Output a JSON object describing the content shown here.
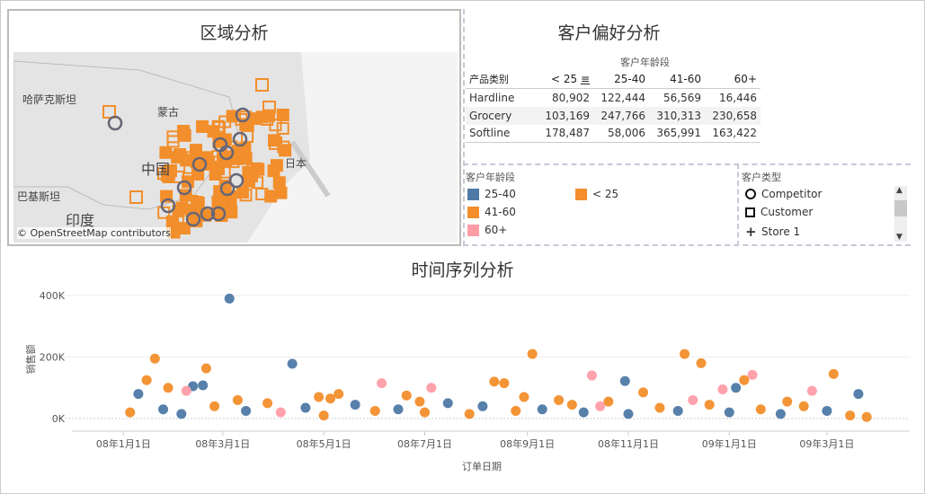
{
  "region": {
    "title": "区域分析",
    "labels": [
      "哈萨克斯坦",
      "蒙古",
      "中国",
      "日本",
      "巴基斯坦",
      "印度"
    ],
    "attribution": "© OpenStreetMap contributors"
  },
  "preference": {
    "title": "客户偏好分析",
    "column_group": "客户年龄段",
    "row_header": "产品类别",
    "columns": [
      "< 25",
      "25-40",
      "41-60",
      "60+"
    ],
    "rows": [
      {
        "name": "Hardline",
        "values": [
          "80,902",
          "122,444",
          "56,569",
          "16,446"
        ]
      },
      {
        "name": "Grocery",
        "values": [
          "103,169",
          "247,766",
          "310,313",
          "230,658"
        ]
      },
      {
        "name": "Softline",
        "values": [
          "178,487",
          "58,006",
          "365,991",
          "163,422"
        ]
      }
    ]
  },
  "age_legend": {
    "title": "客户年龄段",
    "items": [
      {
        "label": "25-40",
        "color": "#4e79a7"
      },
      {
        "label": "< 25",
        "color": "#f28e2b"
      },
      {
        "label": "41-60",
        "color": "#f28e2b"
      },
      {
        "label": "60+",
        "color": "#ff9da7"
      }
    ]
  },
  "type_legend": {
    "title": "客户类型",
    "items": [
      {
        "label": "Competitor",
        "icon": "circle-icon"
      },
      {
        "label": "Customer",
        "icon": "square-icon"
      },
      {
        "label": "Store 1",
        "icon": "plus-icon"
      }
    ]
  },
  "chart_data": {
    "type": "scatter",
    "title": "时间序列分析",
    "xlabel": "订单日期",
    "ylabel": "销售额",
    "ylim": [
      0,
      400000
    ],
    "yticks": [
      {
        "v": 0,
        "label": "0K"
      },
      {
        "v": 200000,
        "label": "200K"
      },
      {
        "v": 400000,
        "label": "400K"
      }
    ],
    "xticks": [
      {
        "d": "2008-01-01",
        "label": "08年1月1日"
      },
      {
        "d": "2008-03-01",
        "label": "08年3月1日"
      },
      {
        "d": "2008-05-01",
        "label": "08年5月1日"
      },
      {
        "d": "2008-07-01",
        "label": "08年7月1日"
      },
      {
        "d": "2008-09-01",
        "label": "08年9月1日"
      },
      {
        "d": "2008-11-01",
        "label": "08年11月1日"
      },
      {
        "d": "2009-01-01",
        "label": "09年1月1日"
      },
      {
        "d": "2009-03-01",
        "label": "09年3月1日"
      }
    ],
    "xlim": [
      "2007-11-20",
      "2009-04-20"
    ],
    "colors": {
      "25-40": "#4e79a7",
      "< 25": "#f28e2b",
      "41-60": "#f28e2b",
      "60+": "#ff9da7"
    },
    "points": [
      [
        "2008-03-05",
        390000,
        "25-40"
      ],
      [
        "2008-01-20",
        195000,
        "< 25"
      ],
      [
        "2008-02-20",
        163000,
        "< 25"
      ],
      [
        "2008-04-12",
        178000,
        "25-40"
      ],
      [
        "2008-09-04",
        210000,
        "41-60"
      ],
      [
        "2008-12-05",
        210000,
        "41-60"
      ],
      [
        "2008-12-15",
        180000,
        "41-60"
      ],
      [
        "2009-03-05",
        145000,
        "< 25"
      ],
      [
        "2009-01-15",
        142000,
        "60+"
      ],
      [
        "2008-10-30",
        122000,
        "25-40"
      ],
      [
        "2008-10-10",
        140000,
        "60+"
      ],
      [
        "2008-01-10",
        80000,
        "25-40"
      ],
      [
        "2008-01-15",
        125000,
        "< 25"
      ],
      [
        "2008-01-28",
        100000,
        "< 25"
      ],
      [
        "2008-02-12",
        105000,
        "25-40"
      ],
      [
        "2008-02-18",
        108000,
        "25-40"
      ],
      [
        "2008-02-08",
        90000,
        "60+"
      ],
      [
        "2008-08-12",
        120000,
        "< 25"
      ],
      [
        "2008-08-18",
        115000,
        "< 25"
      ],
      [
        "2008-06-05",
        115000,
        "60+"
      ],
      [
        "2008-07-05",
        100000,
        "60+"
      ],
      [
        "2009-01-05",
        100000,
        "25-40"
      ],
      [
        "2009-01-10",
        125000,
        "< 25"
      ],
      [
        "2008-12-28",
        95000,
        "60+"
      ],
      [
        "2009-03-20",
        80000,
        "25-40"
      ],
      [
        "2009-02-20",
        90000,
        "60+"
      ],
      [
        "2008-05-10",
        80000,
        "< 25"
      ],
      [
        "2008-06-20",
        75000,
        "< 25"
      ],
      [
        "2008-09-20",
        60000,
        "< 25"
      ],
      [
        "2008-11-10",
        85000,
        "< 25"
      ],
      [
        "2008-01-05",
        20000,
        "< 25"
      ],
      [
        "2008-01-25",
        30000,
        "25-40"
      ],
      [
        "2008-02-05",
        15000,
        "25-40"
      ],
      [
        "2008-02-25",
        40000,
        "< 25"
      ],
      [
        "2008-03-15",
        25000,
        "25-40"
      ],
      [
        "2008-03-28",
        50000,
        "< 25"
      ],
      [
        "2008-04-05",
        20000,
        "60+"
      ],
      [
        "2008-04-20",
        35000,
        "25-40"
      ],
      [
        "2008-05-01",
        10000,
        "< 25"
      ],
      [
        "2008-05-20",
        45000,
        "25-40"
      ],
      [
        "2008-06-01",
        25000,
        "< 25"
      ],
      [
        "2008-06-15",
        30000,
        "25-40"
      ],
      [
        "2008-07-01",
        20000,
        "< 25"
      ],
      [
        "2008-07-15",
        50000,
        "25-40"
      ],
      [
        "2008-07-28",
        15000,
        "< 25"
      ],
      [
        "2008-08-05",
        40000,
        "25-40"
      ],
      [
        "2008-08-25",
        25000,
        "< 25"
      ],
      [
        "2008-09-10",
        30000,
        "25-40"
      ],
      [
        "2008-09-28",
        45000,
        "< 25"
      ],
      [
        "2008-10-05",
        20000,
        "25-40"
      ],
      [
        "2008-10-20",
        55000,
        "< 25"
      ],
      [
        "2008-11-01",
        15000,
        "25-40"
      ],
      [
        "2008-11-20",
        35000,
        "< 25"
      ],
      [
        "2008-12-01",
        25000,
        "25-40"
      ],
      [
        "2008-12-20",
        45000,
        "< 25"
      ],
      [
        "2009-01-01",
        20000,
        "25-40"
      ],
      [
        "2009-01-20",
        30000,
        "< 25"
      ],
      [
        "2009-02-01",
        15000,
        "25-40"
      ],
      [
        "2009-02-15",
        40000,
        "< 25"
      ],
      [
        "2009-03-01",
        25000,
        "25-40"
      ],
      [
        "2009-03-15",
        10000,
        "< 25"
      ],
      [
        "2009-03-25",
        5000,
        "< 25"
      ],
      [
        "2008-03-10",
        60000,
        "< 25"
      ],
      [
        "2008-05-05",
        65000,
        "< 25"
      ],
      [
        "2008-08-30",
        70000,
        "< 25"
      ],
      [
        "2008-10-15",
        40000,
        "60+"
      ],
      [
        "2008-12-10",
        60000,
        "60+"
      ],
      [
        "2009-02-05",
        55000,
        "< 25"
      ],
      [
        "2008-04-28",
        70000,
        "< 25"
      ],
      [
        "2008-06-28",
        55000,
        "< 25"
      ]
    ]
  }
}
